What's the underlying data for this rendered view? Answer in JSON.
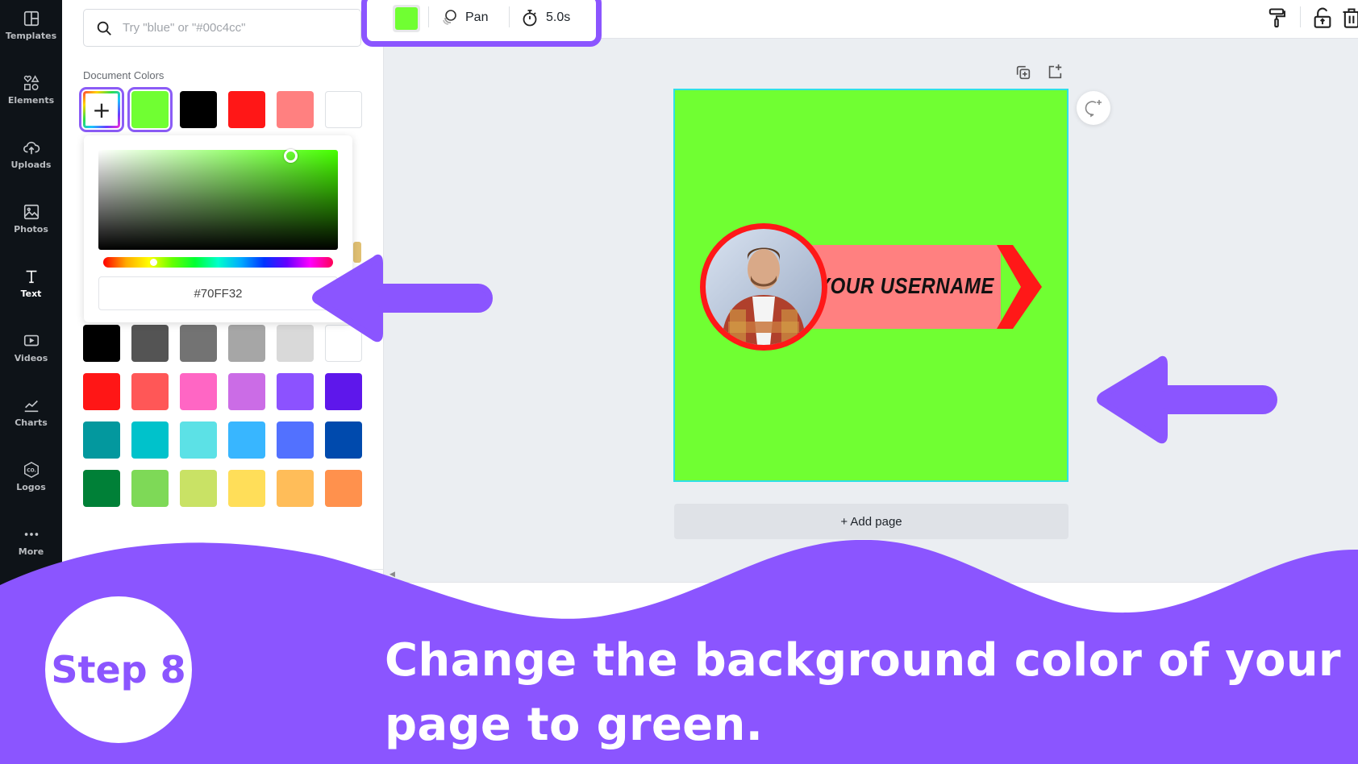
{
  "sidebar": {
    "items": [
      {
        "label": "Templates",
        "icon": "templates-icon"
      },
      {
        "label": "Elements",
        "icon": "elements-icon"
      },
      {
        "label": "Uploads",
        "icon": "upload-cloud-icon"
      },
      {
        "label": "Photos",
        "icon": "photo-icon"
      },
      {
        "label": "Text",
        "icon": "text-icon",
        "active": true
      },
      {
        "label": "Videos",
        "icon": "video-icon"
      },
      {
        "label": "Charts",
        "icon": "chart-line-icon"
      },
      {
        "label": "Logos",
        "icon": "logo-badge-icon"
      },
      {
        "label": "More",
        "icon": "more-dots-icon"
      }
    ]
  },
  "color_panel": {
    "search_placeholder": "Try \"blue\" or \"#00c4cc\"",
    "document_colors_label": "Document Colors",
    "document_colors": [
      "#70ff32",
      "#000000",
      "#ff1717",
      "#ff8080",
      "#ffffff"
    ],
    "selected_color": "#70ff32",
    "picker": {
      "hex_value": "#70FF32",
      "hue_color": "#46ff00"
    },
    "default_colors": [
      [
        "#000000",
        "#545454",
        "#737373",
        "#a6a6a6",
        "#d9d9d9",
        "#ffffff"
      ],
      [
        "#ff1616",
        "#ff5757",
        "#ff66c4",
        "#cb6ce6",
        "#8c52ff",
        "#5e17eb"
      ],
      [
        "#03989e",
        "#00c2cb",
        "#5ce1e6",
        "#38b6ff",
        "#5271ff",
        "#004aad"
      ],
      [
        "#008037",
        "#7ed957",
        "#c9e265",
        "#ffde59",
        "#ffbd59",
        "#ff914d"
      ]
    ]
  },
  "toolbar": {
    "bg_color": "#70ff32",
    "animate_label": "Pan",
    "duration_label": "5.0s"
  },
  "canvas": {
    "page_bg": "#70ff32",
    "banner_text": "YOUR USERNAME",
    "banner_color": "#ff8080",
    "accent_red": "#ff1818",
    "add_page_label": "+ Add page"
  },
  "tutorial": {
    "step_label": "Step 8",
    "instruction": "Change the background color of your page to green.",
    "accent": "#8b55ff"
  }
}
